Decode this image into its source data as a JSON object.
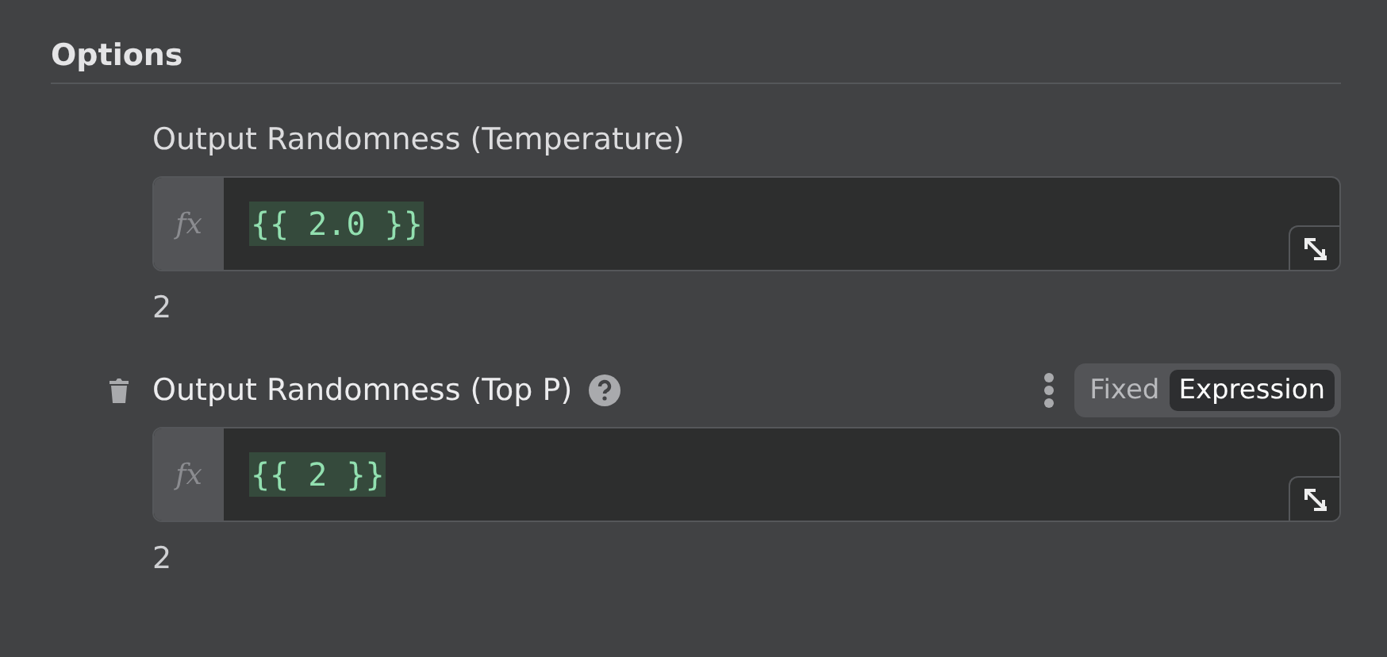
{
  "section": {
    "title": "Options"
  },
  "parameters": [
    {
      "label": "Output Randomness (Temperature)",
      "hovered": false,
      "fx": "fx",
      "expression": "{{ 2.0 }}",
      "result": "2"
    },
    {
      "label": "Output Randomness (Top P)",
      "hovered": true,
      "fx": "fx",
      "expression": "{{ 2 }}",
      "result": "2",
      "mode_options": [
        {
          "label": "Fixed",
          "selected": false
        },
        {
          "label": "Expression",
          "selected": true
        }
      ]
    }
  ]
}
